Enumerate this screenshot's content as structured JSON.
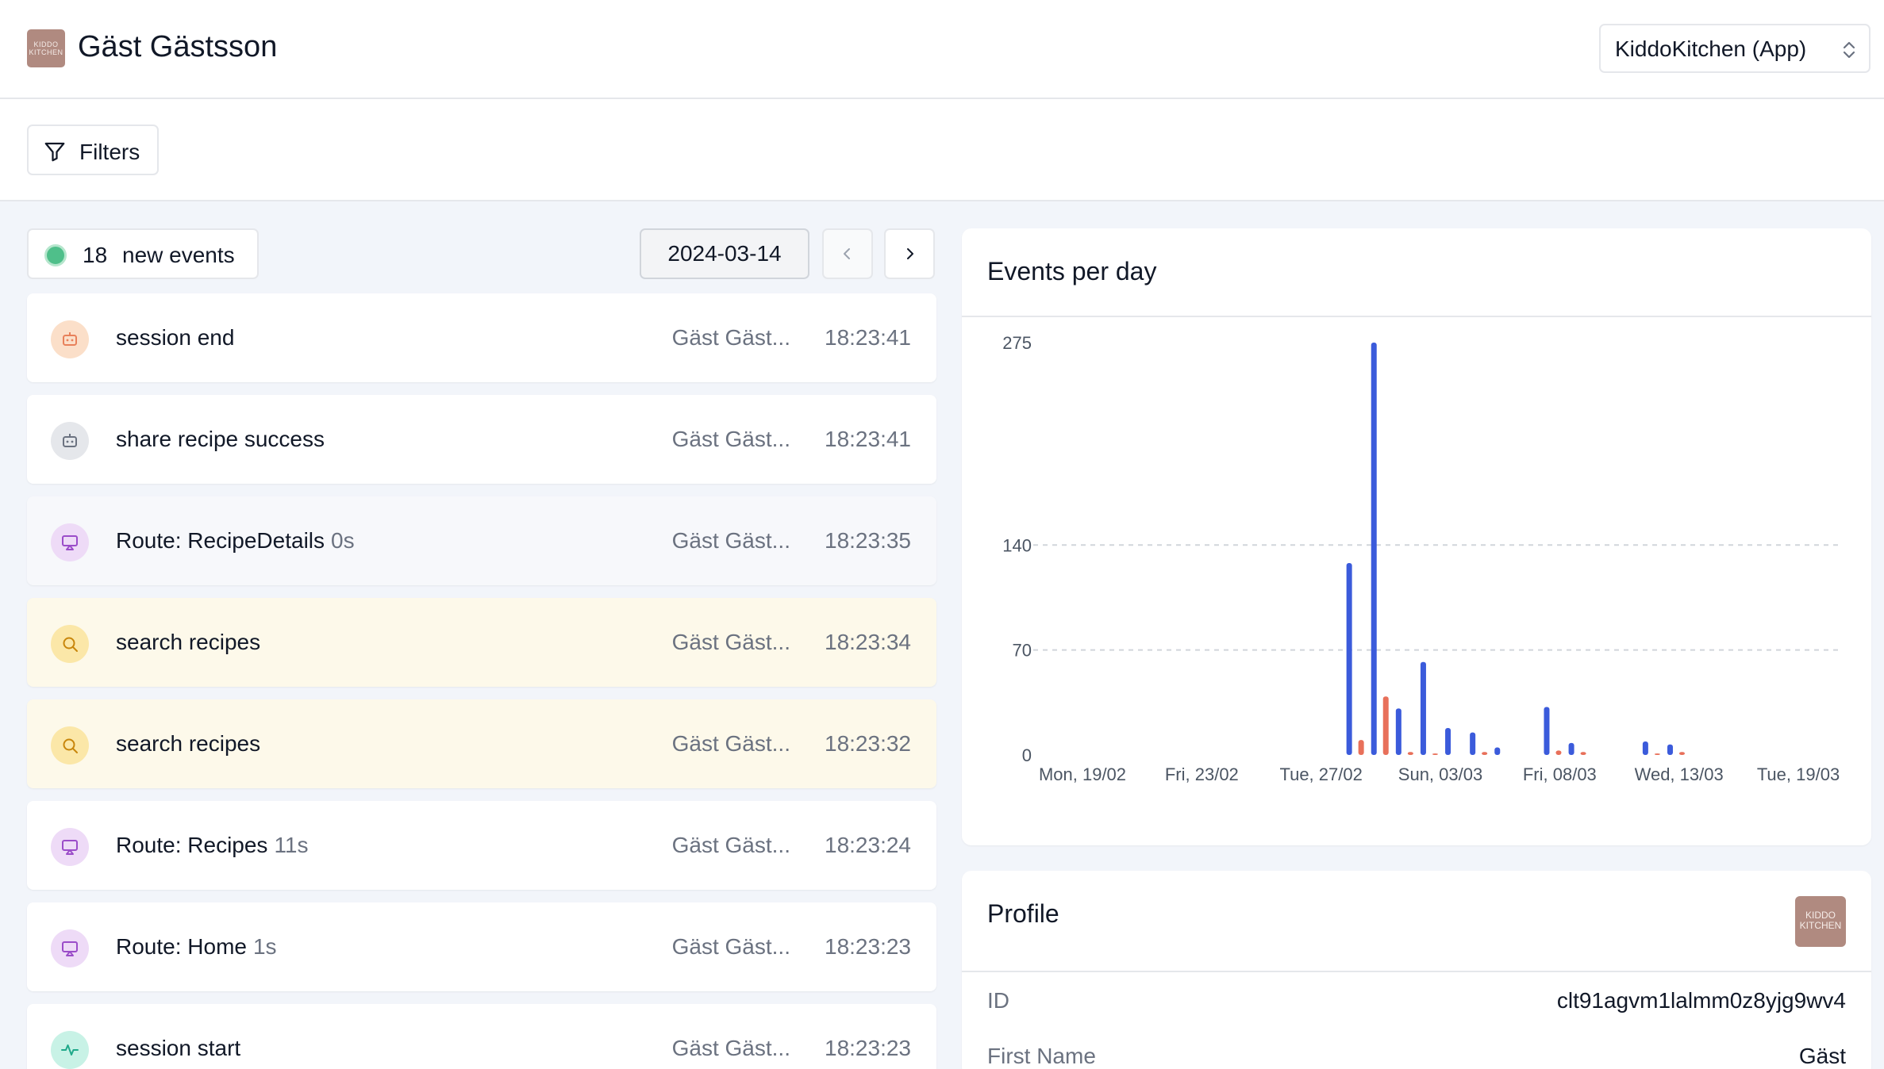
{
  "header": {
    "logo_text": "KIDDO KITCHEN",
    "user_name": "Gäst Gästsson",
    "app_selector": "KiddoKitchen (App)"
  },
  "toolbar": {
    "filters_label": "Filters"
  },
  "feed": {
    "new_count": "18",
    "new_label": "new events",
    "date": "2024-03-14",
    "events": [
      {
        "name": "session end",
        "duration": "",
        "user": "Gäst Gäst...",
        "time": "18:23:41",
        "icon": "robot-icon",
        "color": "#e8805a"
      },
      {
        "name": "share recipe success",
        "duration": "",
        "user": "Gäst Gäst...",
        "time": "18:23:41",
        "icon": "robot-icon",
        "color": "#6b7280"
      },
      {
        "name": "Route: RecipeDetails",
        "duration": "0s",
        "user": "Gäst Gäst...",
        "time": "18:23:35",
        "icon": "screen-icon",
        "color": "#9b4dc9"
      },
      {
        "name": "search recipes",
        "duration": "",
        "user": "Gäst Gäst...",
        "time": "18:23:34",
        "icon": "search-icon",
        "color": "#c8860b"
      },
      {
        "name": "search recipes",
        "duration": "",
        "user": "Gäst Gäst...",
        "time": "18:23:32",
        "icon": "search-icon",
        "color": "#c8860b"
      },
      {
        "name": "Route: Recipes",
        "duration": "11s",
        "user": "Gäst Gäst...",
        "time": "18:23:24",
        "icon": "screen-icon",
        "color": "#9b4dc9"
      },
      {
        "name": "Route: Home",
        "duration": "1s",
        "user": "Gäst Gäst...",
        "time": "18:23:23",
        "icon": "screen-icon",
        "color": "#9b4dc9"
      },
      {
        "name": "session start",
        "duration": "",
        "user": "Gäst Gäst...",
        "time": "18:23:23",
        "icon": "pulse-icon",
        "color": "#1fa98a"
      }
    ]
  },
  "chart_card": {
    "title": "Events per day"
  },
  "chart_data": {
    "type": "bar",
    "title": "Events per day",
    "ylim": [
      0,
      275
    ],
    "y_ticks": [
      0,
      70,
      140,
      275
    ],
    "x_tick_labels": [
      "Mon, 19/02",
      "Fri, 23/02",
      "Tue, 27/02",
      "Sun, 03/03",
      "Fri, 08/03",
      "Wed, 13/03",
      "Tue, 19/03"
    ],
    "grid": "dashed horizontal at 70 and 140",
    "series": [
      {
        "color": "#3b5bdb",
        "points": [
          {
            "x": "2024-03-01",
            "y": 128
          },
          {
            "x": "2024-03-02",
            "y": 275
          },
          {
            "x": "2024-03-03",
            "y": 31
          },
          {
            "x": "2024-03-04",
            "y": 62
          },
          {
            "x": "2024-03-05",
            "y": 18
          },
          {
            "x": "2024-03-06",
            "y": 15
          },
          {
            "x": "2024-03-07",
            "y": 5
          },
          {
            "x": "2024-03-09",
            "y": 32
          },
          {
            "x": "2024-03-10",
            "y": 8
          },
          {
            "x": "2024-03-13",
            "y": 9
          },
          {
            "x": "2024-03-14",
            "y": 7
          }
        ]
      },
      {
        "color": "#e8705a",
        "points": [
          {
            "x": "2024-03-01",
            "y": 10
          },
          {
            "x": "2024-03-02",
            "y": 39
          },
          {
            "x": "2024-03-03",
            "y": 2
          },
          {
            "x": "2024-03-04",
            "y": 1
          },
          {
            "x": "2024-03-06",
            "y": 2
          },
          {
            "x": "2024-03-09",
            "y": 3
          },
          {
            "x": "2024-03-10",
            "y": 2
          },
          {
            "x": "2024-03-13",
            "y": 1
          },
          {
            "x": "2024-03-14",
            "y": 2
          }
        ]
      }
    ]
  },
  "profile": {
    "title": "Profile",
    "avatar_text": "KIDDO KITCHEN",
    "rows": [
      {
        "label": "ID",
        "value": "clt91agvm1lalmm0z8yjg9wv4"
      },
      {
        "label": "First Name",
        "value": "Gäst"
      }
    ]
  }
}
